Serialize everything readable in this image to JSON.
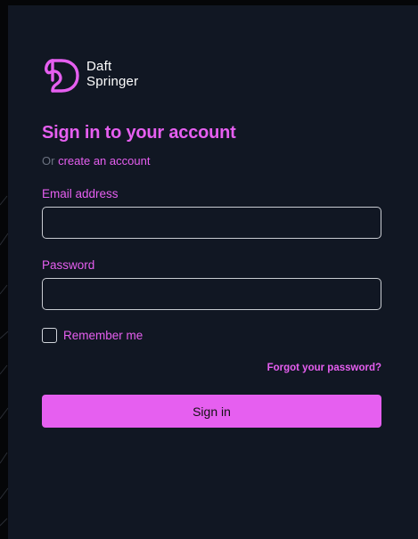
{
  "brand": {
    "line1": "Daft",
    "line2": "Springer",
    "accent_color": "#e65ff0",
    "panel_color": "#111723"
  },
  "form": {
    "title": "Sign in to your account",
    "or_text": "Or",
    "create_account_link": "create an account",
    "email_label": "Email address",
    "email_value": "",
    "password_label": "Password",
    "password_value": "",
    "remember_label": "Remember me",
    "remember_checked": false,
    "forgot_link": "Forgot your password?",
    "submit_label": "Sign in"
  }
}
